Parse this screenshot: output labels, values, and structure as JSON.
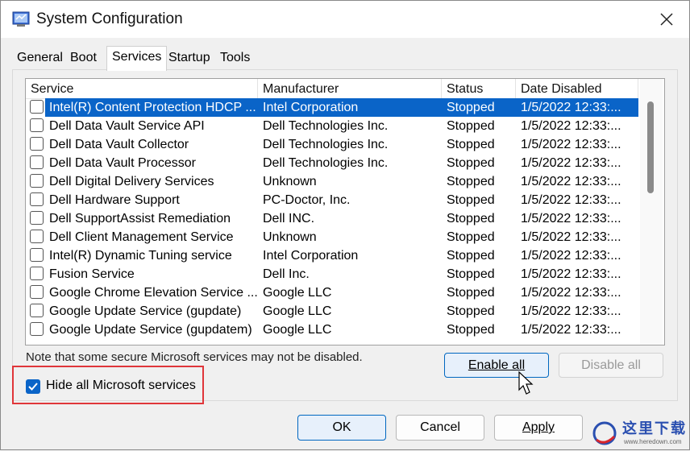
{
  "window": {
    "title": "System Configuration"
  },
  "tabs": [
    {
      "label": "General"
    },
    {
      "label": "Boot"
    },
    {
      "label": "Services"
    },
    {
      "label": "Startup"
    },
    {
      "label": "Tools"
    }
  ],
  "services": {
    "columns": {
      "service": "Service",
      "manufacturer": "Manufacturer",
      "status": "Status",
      "date": "Date Disabled"
    },
    "rows": [
      {
        "name": "Intel(R) Content Protection HDCP ...",
        "manufacturer": "Intel Corporation",
        "status": "Stopped",
        "date": "1/5/2022 12:33:..."
      },
      {
        "name": "Dell Data Vault Service API",
        "manufacturer": "Dell Technologies Inc.",
        "status": "Stopped",
        "date": "1/5/2022 12:33:..."
      },
      {
        "name": "Dell Data Vault Collector",
        "manufacturer": "Dell Technologies Inc.",
        "status": "Stopped",
        "date": "1/5/2022 12:33:..."
      },
      {
        "name": "Dell Data Vault Processor",
        "manufacturer": "Dell Technologies Inc.",
        "status": "Stopped",
        "date": "1/5/2022 12:33:..."
      },
      {
        "name": "Dell Digital Delivery Services",
        "manufacturer": "Unknown",
        "status": "Stopped",
        "date": "1/5/2022 12:33:..."
      },
      {
        "name": "Dell Hardware Support",
        "manufacturer": "PC-Doctor, Inc.",
        "status": "Stopped",
        "date": "1/5/2022 12:33:..."
      },
      {
        "name": "Dell SupportAssist Remediation",
        "manufacturer": "Dell INC.",
        "status": "Stopped",
        "date": "1/5/2022 12:33:..."
      },
      {
        "name": "Dell Client Management Service",
        "manufacturer": "Unknown",
        "status": "Stopped",
        "date": "1/5/2022 12:33:..."
      },
      {
        "name": "Intel(R) Dynamic Tuning service",
        "manufacturer": "Intel Corporation",
        "status": "Stopped",
        "date": "1/5/2022 12:33:..."
      },
      {
        "name": "Fusion Service",
        "manufacturer": "Dell Inc.",
        "status": "Stopped",
        "date": "1/5/2022 12:33:..."
      },
      {
        "name": "Google Chrome Elevation Service ...",
        "manufacturer": "Google LLC",
        "status": "Stopped",
        "date": "1/5/2022 12:33:..."
      },
      {
        "name": "Google Update Service (gupdate)",
        "manufacturer": "Google LLC",
        "status": "Stopped",
        "date": "1/5/2022 12:33:..."
      },
      {
        "name": "Google Update Service (gupdatem)",
        "manufacturer": "Google LLC",
        "status": "Stopped",
        "date": "1/5/2022 12:33:..."
      }
    ]
  },
  "note": "Note that some secure Microsoft services may not be disabled.",
  "enable_all": "Enable all",
  "disable_all": "Disable all",
  "hide_ms": {
    "label": "Hide all Microsoft services",
    "checked": true
  },
  "footer": {
    "ok": "OK",
    "cancel": "Cancel",
    "apply": "Apply"
  },
  "watermark": {
    "text": "这里下载",
    "url": "www.heredown.com"
  },
  "colors": {
    "selection": "#0a64c8",
    "highlight_box": "#e0363a",
    "focus": "#0067c0"
  }
}
